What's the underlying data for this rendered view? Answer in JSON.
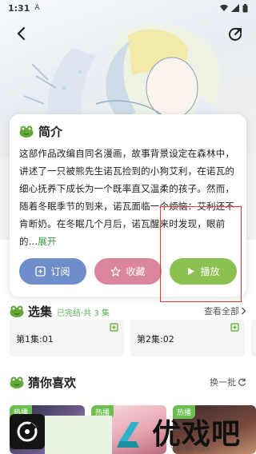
{
  "status_bar": {
    "time": "1:31",
    "sim_indicator": "A"
  },
  "intro": {
    "title": "简介",
    "text": "这部作品改编自同名漫画，故事背景设定在森林中，讲述了一只被熊先生诺瓦捡到的小狗艾利，在诺瓦的细心抚养下成长为一个既率直又温柔的孩子。然而，随着冬眠季节的到来，诺瓦面临一个烦恼：艾利还不肯断奶。在冬眠几个月后，诺瓦醒来时发现，眼前的...",
    "expand_label": "展开",
    "buttons": {
      "subscribe": "订阅",
      "favorite": "收藏",
      "play": "播放"
    }
  },
  "episodes": {
    "title": "选集",
    "status": "已完结·共 3 集",
    "view_all": "查看全部",
    "items": [
      {
        "label": "第1集:01"
      },
      {
        "label": "第2集:02"
      }
    ]
  },
  "recommend": {
    "title": "猜你喜欢",
    "refresh": "换一批",
    "badges": [
      "热播",
      "热播",
      "热播"
    ]
  },
  "watermark": {
    "text": "优戏吧",
    "sub": "YOUXI8.COM"
  },
  "colors": {
    "accent_green": "#8cc152",
    "subscribe_blue": "#6f8ec9",
    "favorite_pink": "#d9869e",
    "highlight_red": "#e53935"
  }
}
